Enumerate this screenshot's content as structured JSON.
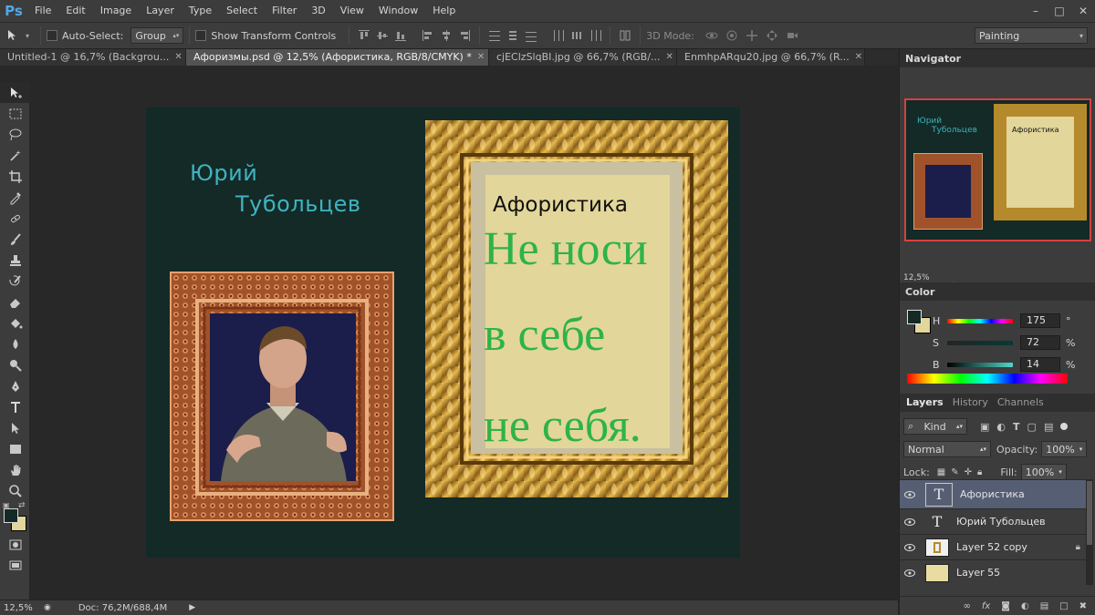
{
  "app": {
    "logo": "Ps"
  },
  "menu": [
    "File",
    "Edit",
    "Image",
    "Layer",
    "Type",
    "Select",
    "Filter",
    "3D",
    "View",
    "Window",
    "Help"
  ],
  "options_bar": {
    "auto_select_label": "Auto-Select:",
    "auto_select_value": "Group",
    "show_transform_label": "Show Transform Controls",
    "mode_3d_label": "3D Mode:",
    "workspace_value": "Painting"
  },
  "doc_tabs": [
    {
      "label": "Untitled-1 @ 16,7% (Backgrou...",
      "active": false
    },
    {
      "label": "Афоризмы.psd @ 12,5% (Афористика, RGB/8/CMYK) *",
      "active": true
    },
    {
      "label": "cjEClzSlqBI.jpg @ 66,7% (RGB/...",
      "active": false
    },
    {
      "label": "EnmhpARqu20.jpg @ 66,7% (R...",
      "active": false
    }
  ],
  "canvas": {
    "author_line1": "Юрий",
    "author_line2": "Тубольцев",
    "aphorism_title": "Афористика",
    "aphorism_lines": [
      "Не носи",
      "в себе",
      "не себя."
    ]
  },
  "status": {
    "zoom": "12,5%",
    "doc": "Doc: 76,2M/688,4M"
  },
  "navigator": {
    "title": "Navigator",
    "zoom": "12,5%",
    "thumb_author1": "Юрий",
    "thumb_author2": "Тубольцев",
    "thumb_title": "Афористика"
  },
  "color": {
    "title": "Color",
    "h_label": "H",
    "h_value": "175",
    "h_unit": "°",
    "s_label": "S",
    "s_value": "72",
    "s_unit": "%",
    "b_label": "B",
    "b_value": "14",
    "b_unit": "%",
    "fg": "#132a26",
    "bg": "#e3d69a"
  },
  "layers": {
    "tabs": [
      "Layers",
      "History",
      "Channels"
    ],
    "kind_label": "Kind",
    "blend_mode": "Normal",
    "opacity_label": "Opacity:",
    "opacity_value": "100%",
    "lock_label": "Lock:",
    "fill_label": "Fill:",
    "fill_value": "100%",
    "items": [
      {
        "name": "Афористика",
        "type": "text",
        "selected": true,
        "locked": false
      },
      {
        "name": "Юрий  Тубольцев",
        "type": "text",
        "selected": false,
        "locked": false
      },
      {
        "name": "Layer 52 copy",
        "type": "image",
        "selected": false,
        "locked": true
      },
      {
        "name": "Layer 55",
        "type": "image",
        "selected": false,
        "locked": false
      }
    ]
  }
}
